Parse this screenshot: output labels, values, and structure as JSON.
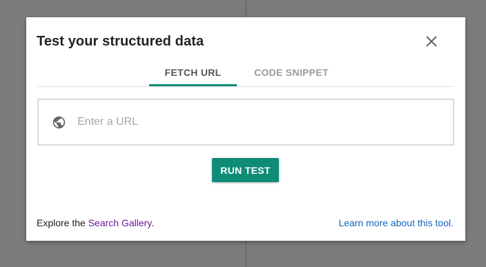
{
  "dialog": {
    "title": "Test your structured data",
    "close_icon": "close-icon"
  },
  "tabs": [
    {
      "label": "FETCH URL",
      "active": true
    },
    {
      "label": "CODE SNIPPET",
      "active": false
    }
  ],
  "url_field": {
    "placeholder": "Enter a URL",
    "value": "",
    "icon": "globe-icon"
  },
  "run_button": {
    "label": "RUN TEST"
  },
  "footer": {
    "explore_prefix": "Explore the ",
    "gallery_link": "Search Gallery",
    "explore_suffix": ".",
    "learn_more_link": "Learn more about this tool."
  },
  "colors": {
    "accent": "#0f8c78",
    "visited_link": "#6a1b9a",
    "link": "#1565c0",
    "backdrop": "#7b7b7b"
  }
}
